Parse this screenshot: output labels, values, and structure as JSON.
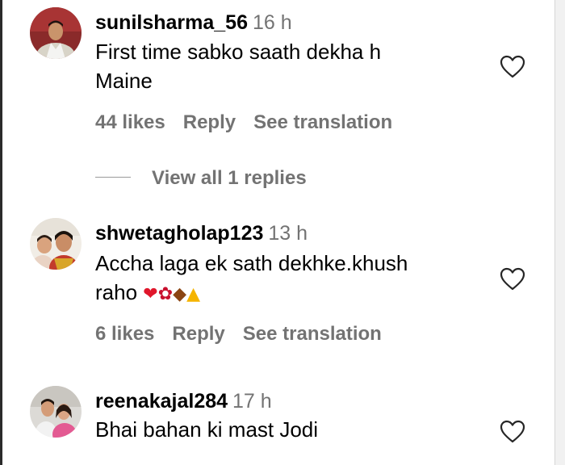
{
  "comments": [
    {
      "username": "sunilsharma_56",
      "time": "16 h",
      "text_line1": "First time sabko saath dekha h",
      "text_line2": "Maine",
      "likes": "44 likes",
      "reply": "Reply",
      "translate": "See translation",
      "view_replies": "View all 1 replies"
    },
    {
      "username": "shwetagholap123",
      "time": "13 h",
      "text_line1": "Accha laga ek sath dekhke.khush",
      "text_line2": "raho",
      "emojis": [
        "red-heart",
        "rose",
        "chocolate-bar",
        "folded-hands"
      ],
      "likes": "6 likes",
      "reply": "Reply",
      "translate": "See translation"
    },
    {
      "username": "reenakajal284",
      "time": "17 h",
      "text_line1": "Bhai bahan ki mast Jodi"
    }
  ],
  "colors": {
    "text": "#000000",
    "muted": "#737373",
    "heart_outline": "#262626"
  }
}
